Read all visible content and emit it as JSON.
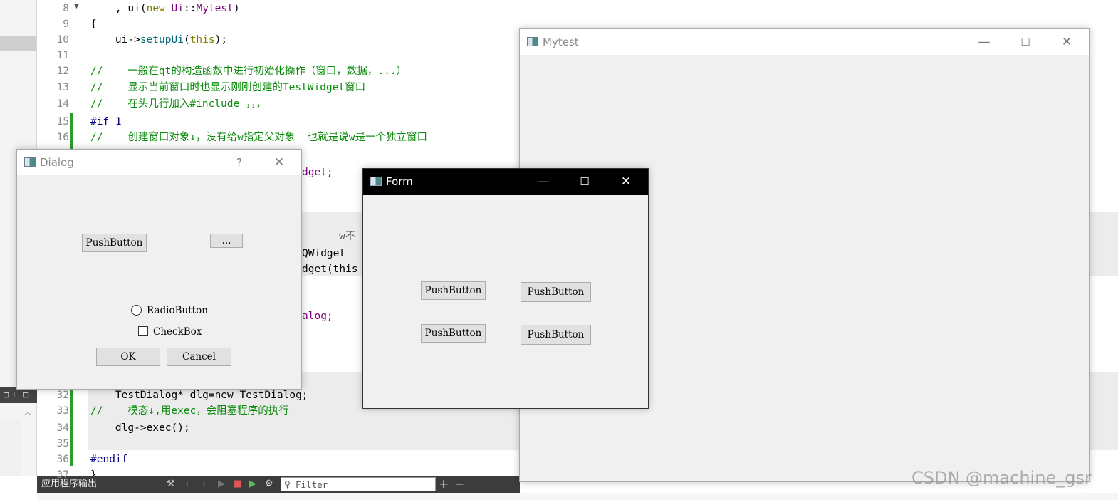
{
  "editor": {
    "lines": [
      {
        "n": "8",
        "segments": [
          {
            "t": "    , ",
            "c": "fr"
          },
          {
            "t": "ui",
            "c": "fr"
          },
          {
            "t": "(",
            "c": "fr"
          },
          {
            "t": "new",
            "c": "kw"
          },
          {
            "t": " ",
            "c": "fr"
          },
          {
            "t": "Ui",
            "c": "ty"
          },
          {
            "t": "::",
            "c": "fr"
          },
          {
            "t": "Mytest",
            "c": "ty"
          },
          {
            "t": ")",
            "c": "fr"
          }
        ]
      },
      {
        "n": "9",
        "segments": [
          {
            "t": "{",
            "c": "fr"
          }
        ]
      },
      {
        "n": "10",
        "segments": [
          {
            "t": "    ui->",
            "c": "fr"
          },
          {
            "t": "setupUi",
            "c": "fn"
          },
          {
            "t": "(",
            "c": "fr"
          },
          {
            "t": "this",
            "c": "kw"
          },
          {
            "t": ");",
            "c": "fr"
          }
        ]
      },
      {
        "n": "11",
        "segments": []
      },
      {
        "n": "12",
        "segments": [
          {
            "t": "//    一般在qt的构造函数中进行初始化操作（窗口，数据，...）",
            "c": "cm"
          }
        ]
      },
      {
        "n": "13",
        "segments": [
          {
            "t": "//    显示当前窗口时也显示刚刚创建的TestWidget窗口",
            "c": "cm"
          }
        ]
      },
      {
        "n": "14",
        "segments": [
          {
            "t": "//    在头几行加入#include ，，，",
            "c": "cm"
          }
        ]
      },
      {
        "n": "15",
        "segments": [
          {
            "t": "#if 1",
            "c": "pp"
          }
        ]
      },
      {
        "n": "16",
        "segments": [
          {
            "t": "//    创建窗口对象↓，没有给w指定父对象  也就是说w是一个独立窗口",
            "c": "cm"
          }
        ]
      },
      {
        "n": "32",
        "segments": [
          {
            "t": "    TestDialog* dlg=new TestDialog;",
            "c": "fr"
          }
        ]
      },
      {
        "n": "33",
        "segments": [
          {
            "t": "//    模态↓,用exec，会阻塞程序的执行",
            "c": "cm"
          }
        ]
      },
      {
        "n": "34",
        "segments": [
          {
            "t": "    dlg->exec();",
            "c": "fr"
          }
        ]
      },
      {
        "n": "35",
        "segments": []
      },
      {
        "n": "36",
        "segments": [
          {
            "t": "#endif",
            "c": "pp"
          }
        ]
      },
      {
        "n": "37",
        "segments": [
          {
            "t": "}",
            "c": "fr"
          }
        ]
      }
    ],
    "fragments": [
      "dget;",
      "w不",
      "QWidget",
      "dget(this",
      "alog;"
    ],
    "mini_toolbar": "⊟+ ⊡"
  },
  "output_bar": {
    "title": "应用程序输出",
    "filter_placeholder": "Filter",
    "icons": [
      "build-icon",
      "back-icon",
      "forward-icon",
      "run-icon",
      "stop-icon",
      "run-debug-icon",
      "settings-icon",
      "filter-icon",
      "add-icon",
      "remove-icon"
    ]
  },
  "windows": {
    "mytest": {
      "title": "Mytest",
      "controls": [
        "—",
        "☐",
        "✕"
      ]
    },
    "dialog": {
      "title": "Dialog",
      "controls": [
        "?",
        "✕"
      ],
      "push_button": "PushButton",
      "tool_button": "...",
      "radio": "RadioButton",
      "checkbox": "CheckBox",
      "ok": "OK",
      "cancel": "Cancel"
    },
    "form": {
      "title": "Form",
      "controls": [
        "—",
        "☐",
        "✕"
      ],
      "buttons": [
        "PushButton",
        "PushButton",
        "PushButton",
        "PushButton"
      ]
    }
  },
  "watermark": "CSDN @machine_gsr",
  "colors": {
    "comment": "#0a8a0a",
    "preprocessor": "#000080",
    "keyword": "#808000",
    "type": "#800080",
    "function": "#00677c",
    "active_titlebar": "#000000",
    "change_bar": "#2e9b2e"
  }
}
